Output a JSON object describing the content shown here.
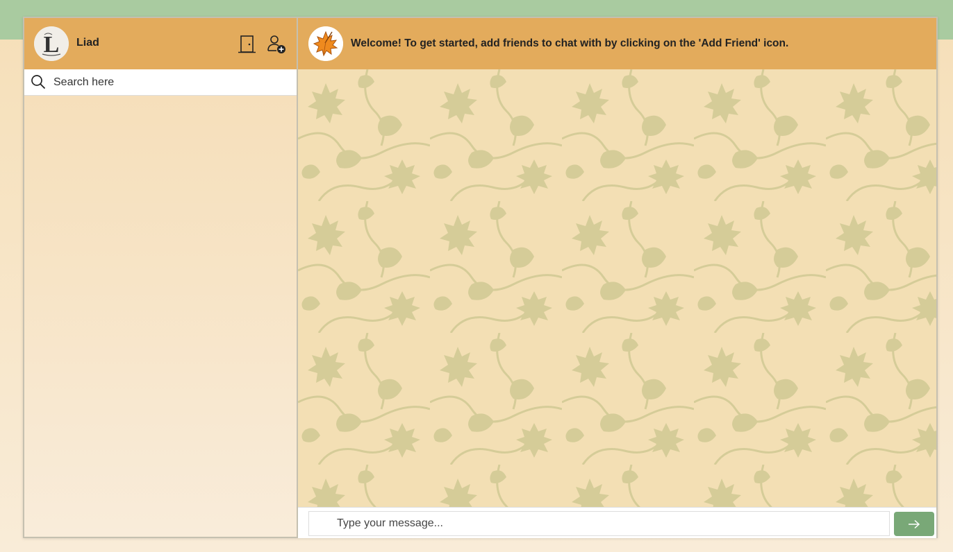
{
  "user": {
    "name": "Liad",
    "avatar_letter": "L"
  },
  "header": {
    "welcome_text": "Welcome! To get started, add friends to chat with by clicking on the 'Add Friend' icon."
  },
  "search": {
    "placeholder": "Search here"
  },
  "composer": {
    "placeholder": "Type your message...",
    "send_icon": "arrow-right-icon"
  },
  "icons": {
    "logout": "door-icon",
    "add_friend": "add-friend-icon",
    "search": "search-icon",
    "app_logo": "maple-leaf-icon"
  },
  "colors": {
    "header": "#e3ab5c",
    "top_band": "#a9cba0",
    "send_button": "#79a877",
    "chat_background": "#f3dfb4",
    "leaf_pattern": "#d5cc98"
  }
}
